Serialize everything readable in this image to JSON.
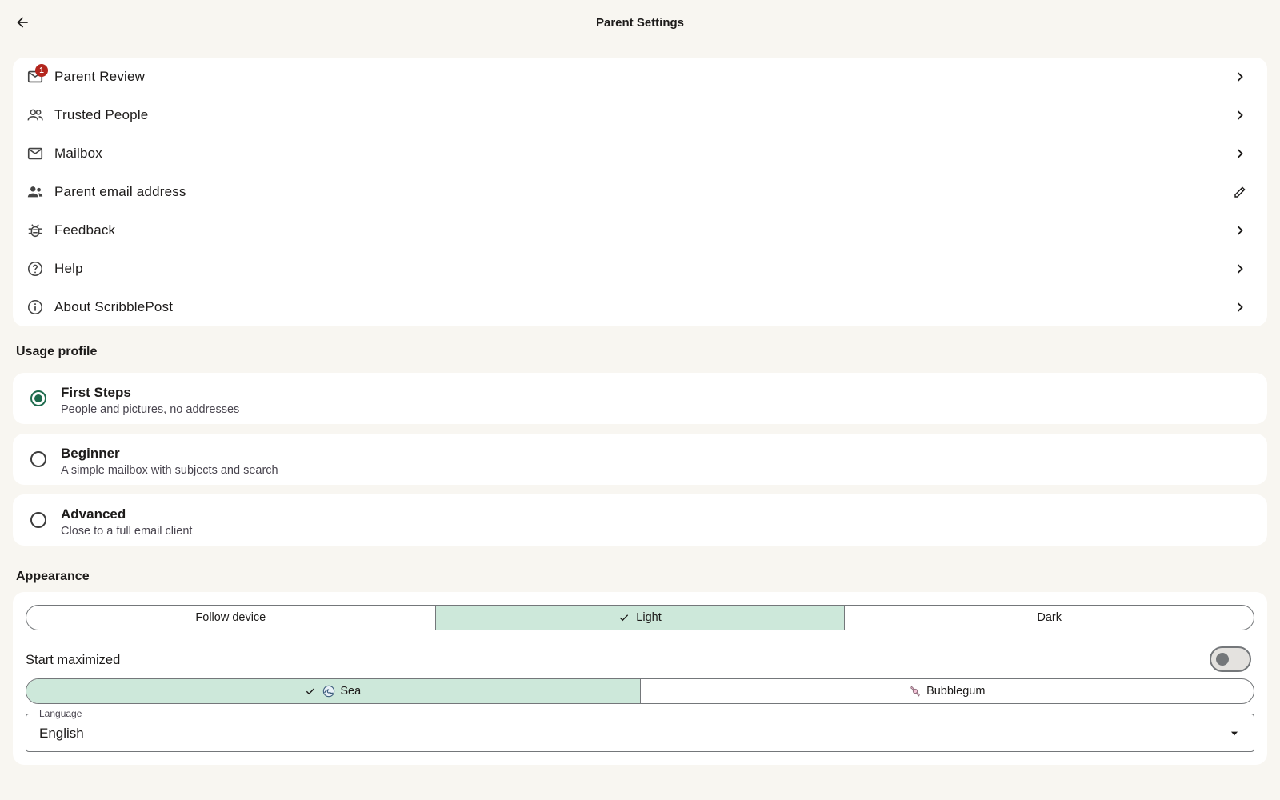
{
  "header": {
    "title": "Parent Settings",
    "back_icon": "arrow-left-icon"
  },
  "menu": {
    "items": [
      {
        "label": "Parent Review",
        "icon": "mail-icon",
        "badge": "1",
        "trail": "chevron-right-icon"
      },
      {
        "label": "Trusted People",
        "icon": "people-icon",
        "trail": "chevron-right-icon"
      },
      {
        "label": "Mailbox",
        "icon": "mail-icon",
        "trail": "chevron-right-icon"
      },
      {
        "label": "Parent email address",
        "icon": "supervisor-icon",
        "trail": "pencil-icon"
      },
      {
        "label": "Feedback",
        "icon": "bug-icon",
        "trail": "chevron-right-icon"
      },
      {
        "label": "Help",
        "icon": "help-circle-icon",
        "trail": "chevron-right-icon"
      },
      {
        "label": "About ScribblePost",
        "icon": "info-icon",
        "trail": "chevron-right-icon"
      }
    ]
  },
  "usage_profile": {
    "title": "Usage profile",
    "options": [
      {
        "title": "First Steps",
        "subtitle": "People and pictures, no addresses",
        "selected": true
      },
      {
        "title": "Beginner",
        "subtitle": "A simple mailbox with subjects and search",
        "selected": false
      },
      {
        "title": "Advanced",
        "subtitle": "Close to a full email client",
        "selected": false
      }
    ]
  },
  "appearance": {
    "title": "Appearance",
    "theme_options": [
      {
        "label": "Follow device",
        "selected": false
      },
      {
        "label": "Light",
        "selected": true
      },
      {
        "label": "Dark",
        "selected": false
      }
    ],
    "start_maximized_label": "Start maximized",
    "start_maximized": false,
    "palette_options": [
      {
        "label": "Sea",
        "icon": "wave-icon",
        "selected": true
      },
      {
        "label": "Bubblegum",
        "icon": "candy-icon",
        "selected": false
      }
    ],
    "language": {
      "label": "Language",
      "value": "English"
    }
  },
  "colors": {
    "background": "#f8f6f1",
    "card": "#ffffff",
    "accent": "#1e6b4d",
    "selected_segment": "#cde8da",
    "badge": "#b3261e"
  }
}
